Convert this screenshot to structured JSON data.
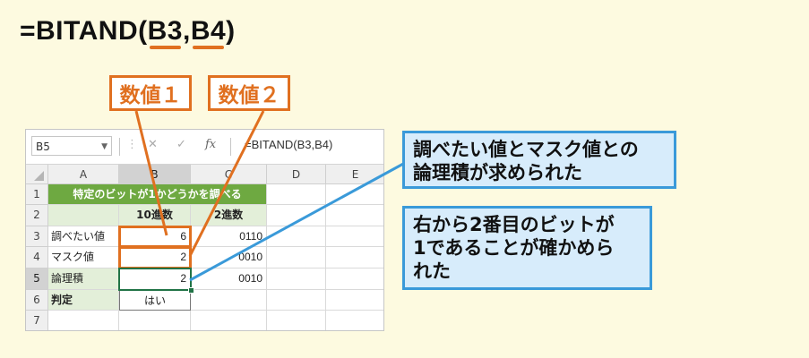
{
  "formula": {
    "prefix": "=BITAND(",
    "arg1": "B3",
    "sep": ",",
    "arg2": "B4",
    "suffix": ")"
  },
  "labels": {
    "number1": "数値１",
    "number2": "数値２"
  },
  "notes": {
    "note1_line1": "調べたい値とマスク値との",
    "note1_line2": "論理積が求められた",
    "note2_line1": "右から2番目のビットが",
    "note2_line2": "1であることが確かめら",
    "note2_line3": "れた"
  },
  "formula_bar": {
    "name_box": "B5",
    "name_dropdown": "▼",
    "cancel_icon": "✕",
    "enter_icon": "✓",
    "fx_label": "fx",
    "formula": "=BITAND(B3,B4)"
  },
  "columns": [
    "A",
    "B",
    "C",
    "D",
    "E"
  ],
  "rows": [
    "1",
    "2",
    "3",
    "4",
    "5",
    "6",
    "7"
  ],
  "sheet": {
    "title": "特定のビットが1かどうかを調べる",
    "header_b": "10進数",
    "header_c": "2進数",
    "r3": {
      "a": "調べたい値",
      "b": "6",
      "c": "0110"
    },
    "r4": {
      "a": "マスク値",
      "b": "2",
      "c": "0010"
    },
    "r5": {
      "a": "論理積",
      "b": "2",
      "c": "0010"
    },
    "r6": {
      "a": "判定",
      "b": "はい"
    }
  },
  "colors": {
    "accent_orange": "#e07020",
    "accent_blue": "#3a9ad9",
    "title_green": "#6ea941",
    "background": "#fdfae0"
  }
}
